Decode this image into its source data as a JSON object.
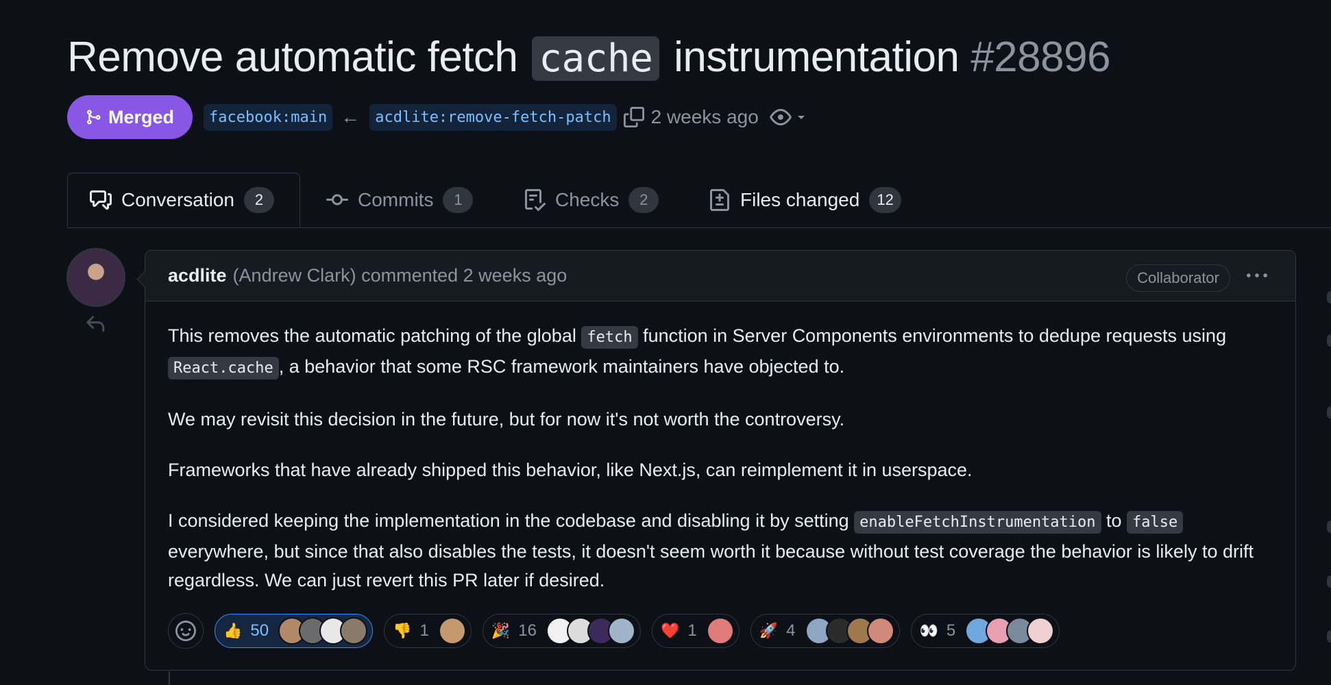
{
  "pr": {
    "title_pre": "Remove automatic fetch ",
    "title_code": "cache",
    "title_post": " instrumentation",
    "number": "#28896",
    "status": "Merged",
    "base_branch": "facebook:main",
    "head_branch": "acdlite:remove-fetch-patch",
    "time": "2 weeks ago"
  },
  "tabs": [
    {
      "label": "Conversation",
      "count": "2"
    },
    {
      "label": "Commits",
      "count": "1"
    },
    {
      "label": "Checks",
      "count": "2"
    },
    {
      "label": "Files changed",
      "count": "12"
    }
  ],
  "comment": {
    "author": "acdlite",
    "meta": "(Andrew Clark) commented 2 weeks ago",
    "badge": "Collaborator",
    "p1_a": "This removes the automatic patching of the global ",
    "p1_code1": "fetch",
    "p1_b": " function in Server Components environments to dedupe requests using ",
    "p1_code2": "React.cache",
    "p1_c": ", a behavior that some RSC framework maintainers have objected to.",
    "p2": "We may revisit this decision in the future, but for now it's not worth the controversy.",
    "p3": "Frameworks that have already shipped this behavior, like Next.js, can reimplement it in userspace.",
    "p4_a": "I considered keeping the implementation in the codebase and disabling it by setting ",
    "p4_code1": "enableFetchInstrumentation",
    "p4_b": " to ",
    "p4_code2": "false",
    "p4_c": " everywhere, but since that also disables the tests, it doesn't seem worth it because without test coverage the behavior is likely to drift regardless. We can just revert this PR later if desired."
  },
  "reactions": [
    {
      "emoji": "👍",
      "count": "50",
      "selected": true
    },
    {
      "emoji": "👎",
      "count": "1"
    },
    {
      "emoji": "🎉",
      "count": "16"
    },
    {
      "emoji": "❤️",
      "count": "1"
    },
    {
      "emoji": "🚀",
      "count": "4"
    },
    {
      "emoji": "👀",
      "count": "5"
    }
  ],
  "colors": {
    "background": "#0d1117",
    "merged": "#8957e5",
    "link": "#79c0ff",
    "border": "#30363d",
    "muted": "#8b949e"
  }
}
